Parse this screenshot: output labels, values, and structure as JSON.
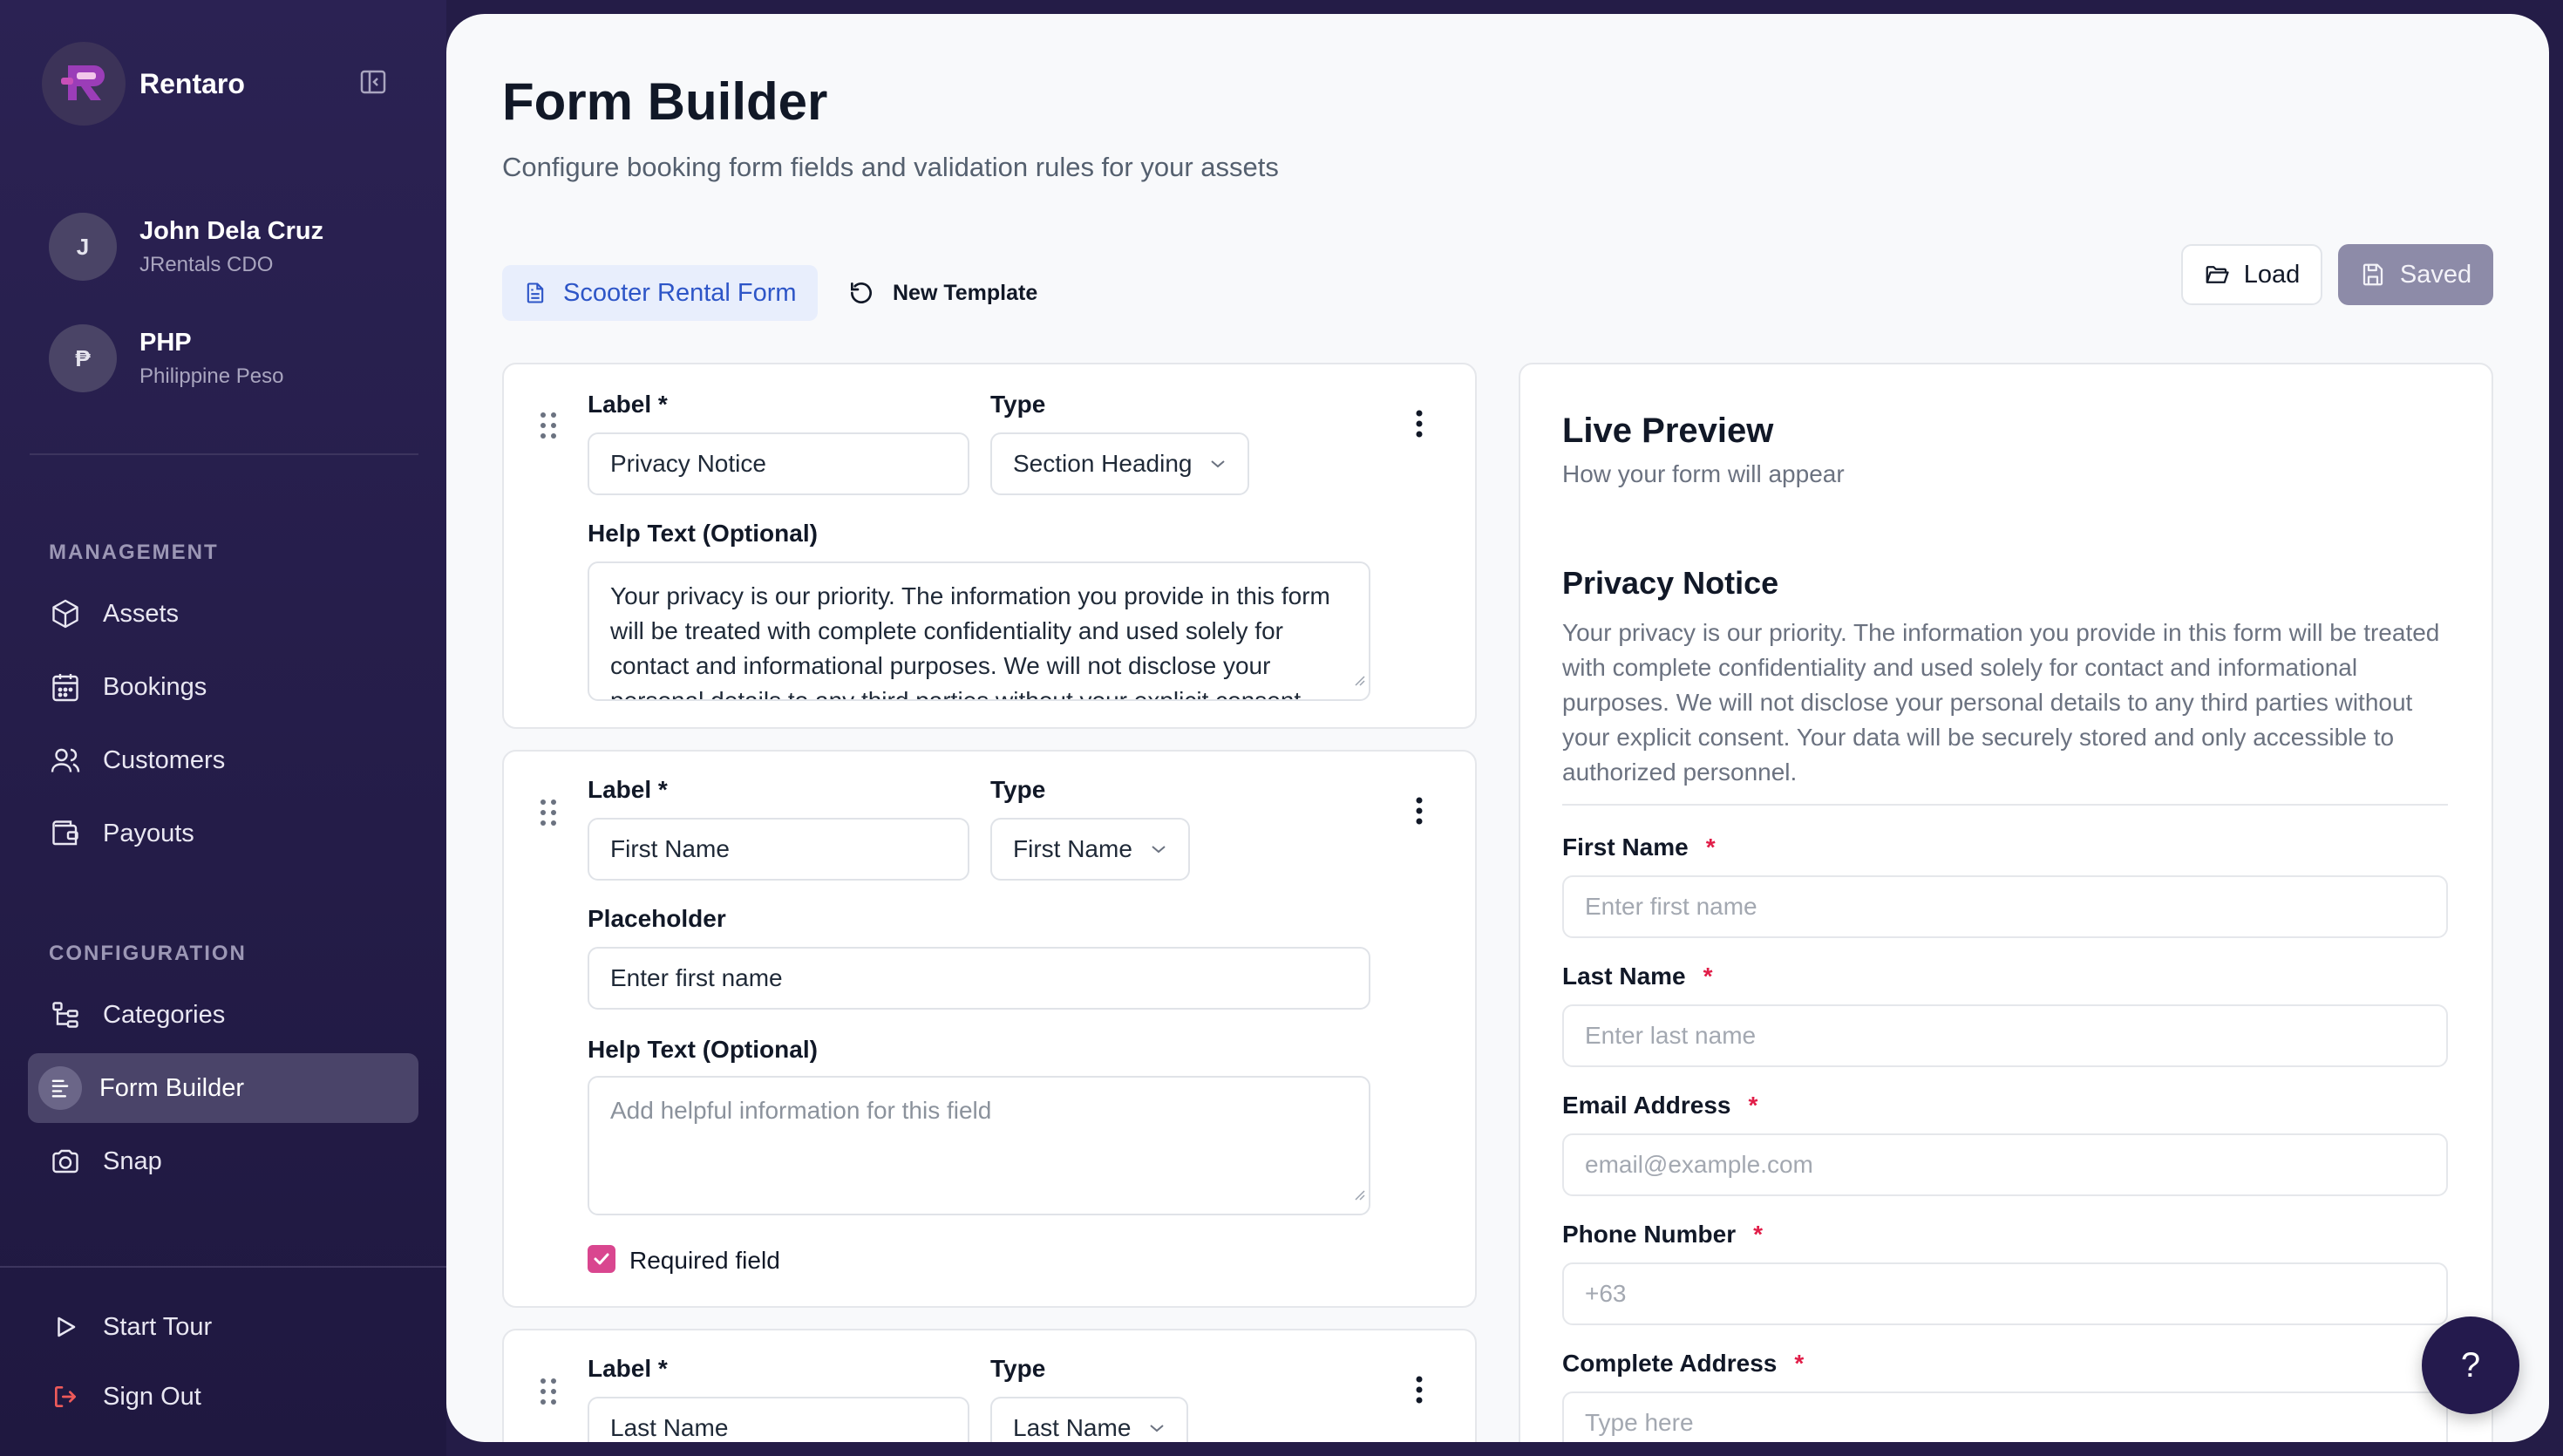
{
  "app": {
    "name": "Rentaro"
  },
  "profile": {
    "user": {
      "initial": "J",
      "name": "John Dela Cruz",
      "role": "JRentals CDO"
    },
    "currency": {
      "symbol": "₱",
      "code": "PHP",
      "name": "Philippine Peso"
    }
  },
  "sidebar": {
    "management_label": "MANAGEMENT",
    "management": [
      {
        "label": "Assets",
        "icon": "box-icon"
      },
      {
        "label": "Bookings",
        "icon": "calendar-icon"
      },
      {
        "label": "Customers",
        "icon": "users-icon"
      },
      {
        "label": "Payouts",
        "icon": "wallet-icon"
      }
    ],
    "configuration_label": "CONFIGURATION",
    "configuration": [
      {
        "label": "Categories",
        "icon": "tree-icon"
      },
      {
        "label": "Form Builder",
        "icon": "form-icon",
        "active": true
      },
      {
        "label": "Snap",
        "icon": "camera-icon"
      }
    ],
    "bottom": [
      {
        "label": "Start Tour",
        "icon": "play-icon"
      },
      {
        "label": "Sign Out",
        "icon": "sign-out-icon"
      }
    ]
  },
  "page": {
    "title": "Form Builder",
    "subtitle": "Configure booking form fields and validation rules for your assets"
  },
  "toolbar": {
    "active_tab": "Scooter Rental Form",
    "new_template": "New Template",
    "load": "Load",
    "saved": "Saved"
  },
  "fields": [
    {
      "label_caption": "Label *",
      "label_value": "Privacy Notice",
      "type_caption": "Type",
      "type_value": "Section Heading",
      "help_caption": "Help Text (Optional)",
      "help_value": "Your privacy is our priority. The information you provide in this form will be treated with complete confidentiality and used solely for contact and informational purposes. We will not disclose your personal details to any third parties without your explicit consent."
    },
    {
      "label_caption": "Label *",
      "label_value": "First Name",
      "type_caption": "Type",
      "type_value": "First Name",
      "placeholder_caption": "Placeholder",
      "placeholder_value": "Enter first name",
      "help_caption": "Help Text (Optional)",
      "help_placeholder": "Add helpful information for this field",
      "required_label": "Required field",
      "required": true
    },
    {
      "label_caption": "Label *",
      "label_value": "Last Name",
      "type_caption": "Type",
      "type_value": "Last Name"
    }
  ],
  "preview": {
    "title": "Live Preview",
    "subtitle": "How your form will appear",
    "heading": "Privacy Notice",
    "paragraph": "Your privacy is our priority. The information you provide in this form will be treated with complete confidentiality and used solely for contact and informational purposes. We will not disclose your personal details to any third parties without your explicit consent. Your data will be securely stored and only accessible to authorized personnel.",
    "required_mark": "*",
    "inputs": [
      {
        "label": "First Name",
        "placeholder": "Enter first name"
      },
      {
        "label": "Last Name",
        "placeholder": "Enter last name"
      },
      {
        "label": "Email Address",
        "placeholder": "email@example.com"
      },
      {
        "label": "Phone Number",
        "placeholder": "+63"
      },
      {
        "label": "Complete Address",
        "placeholder": "Type here"
      }
    ]
  },
  "help_button": "?",
  "colors": {
    "sidebar_bg": "#2b2253",
    "accent_blue": "#2d55c7",
    "checkbox_pink": "#d9468f",
    "required_red": "#e11d48",
    "saved_button": "#8d8ba8"
  }
}
